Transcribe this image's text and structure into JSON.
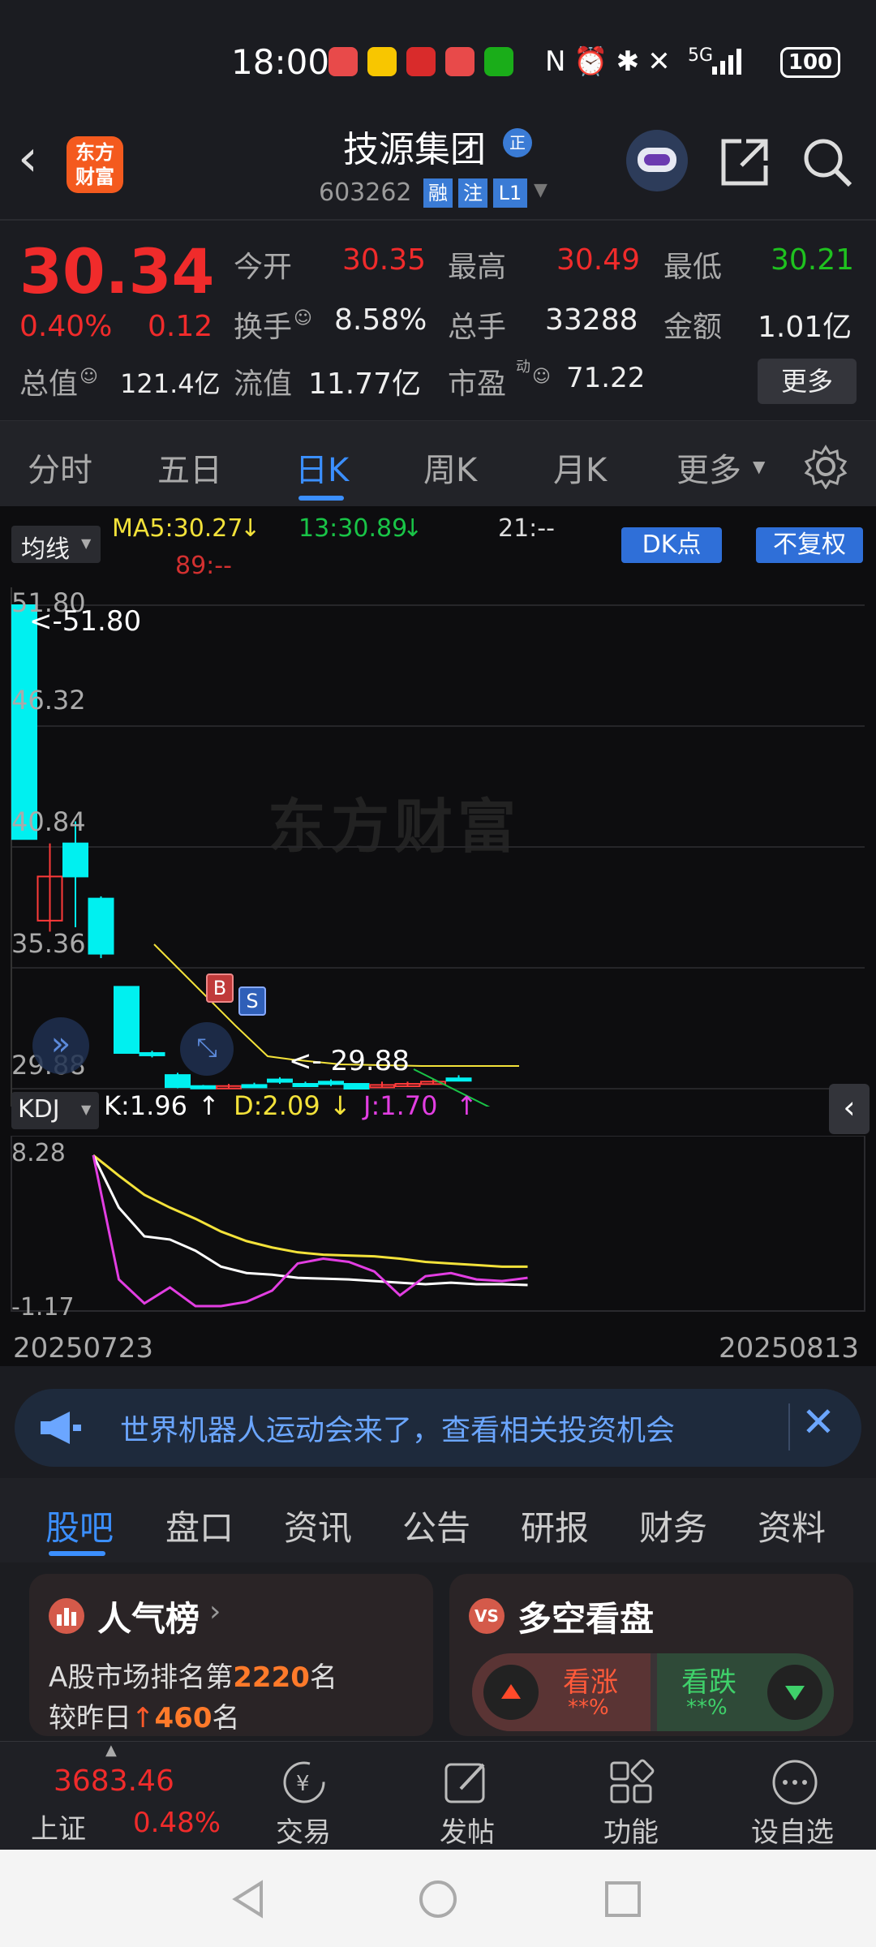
{
  "status": {
    "time": "18:00",
    "battery": "100",
    "net": "5G"
  },
  "header": {
    "logo_line1": "东方",
    "logo_line2": "财富",
    "stock_name": "技源集团",
    "stock_badge": "正",
    "code": "603262",
    "tag_rong": "融",
    "tag_zhu": "注",
    "tag_level": "L1"
  },
  "quote": {
    "price": "30.34",
    "pct": "0.40%",
    "chg": "0.12",
    "open_label": "今开",
    "open": "30.35",
    "high_label": "最高",
    "high": "30.49",
    "low_label": "最低",
    "low": "30.21",
    "turnover_label": "换手",
    "turnover": "8.58%",
    "volume_label": "总手",
    "volume": "33288",
    "amount_label": "金额",
    "amount": "1.01亿",
    "mcap_label": "总值",
    "mcap": "121.4亿",
    "float_label": "流值",
    "float": "11.77亿",
    "pe_label": "市盈",
    "pe_sup": "动",
    "pe": "71.22",
    "more_btn": "更多"
  },
  "period_tabs": [
    "分时",
    "五日",
    "日K",
    "周K",
    "月K",
    "更多"
  ],
  "active_tab": "日K",
  "chart": {
    "ma_btn": "均线",
    "ma5": "MA5:30.27",
    "ma5_arrow": "↓",
    "ma13": "13:30.89",
    "ma13_arrow": "↓",
    "ma21": "21:--",
    "ma89": "89:--",
    "dk_btn": "DK点",
    "fuquan_btn": "不复权",
    "y_top": "51.80",
    "y2": "46.32",
    "y3": "40.84",
    "y4": "35.36",
    "y_bot": "29.88",
    "hi_mark": "51.80",
    "lo_mark": "29.88",
    "buy": "B",
    "sell": "S",
    "kdj_btn": "KDJ",
    "k": "K:1.96",
    "k_arrow": "↑",
    "d": "D:2.09",
    "d_arrow": "↓",
    "j": "J:1.70",
    "j_arrow": "↑",
    "kdj_top": "8.28",
    "kdj_bot": "-1.17",
    "date_start": "20250723",
    "date_end": "20250813",
    "watermark": "东方财富"
  },
  "chart_data": {
    "type": "candlestick",
    "price_axis": [
      29.88,
      51.8
    ],
    "candles": [
      {
        "open": 51.8,
        "close": 41.2,
        "high": 51.8,
        "low": 41.2
      },
      {
        "open": 37.5,
        "close": 39.5,
        "high": 41.0,
        "low": 37.0
      },
      {
        "open": 41.0,
        "close": 39.5,
        "high": 42.0,
        "low": 37.2
      },
      {
        "open": 38.5,
        "close": 36.0,
        "high": 38.6,
        "low": 35.8
      },
      {
        "open": 34.5,
        "close": 31.5,
        "high": 34.5,
        "low": 31.5
      },
      {
        "open": 31.5,
        "close": 31.4,
        "high": 31.6,
        "low": 31.3
      },
      {
        "open": 30.5,
        "close": 29.95,
        "high": 30.6,
        "low": 29.9
      },
      {
        "open": 30.0,
        "close": 29.95,
        "high": 30.05,
        "low": 29.9
      },
      {
        "open": 30.0,
        "close": 30.0,
        "high": 30.1,
        "low": 29.9
      },
      {
        "open": 30.05,
        "close": 30.0,
        "high": 30.15,
        "low": 29.95
      },
      {
        "open": 30.3,
        "close": 30.2,
        "high": 30.4,
        "low": 30.1
      },
      {
        "open": 30.1,
        "close": 30.05,
        "high": 30.2,
        "low": 30.0
      },
      {
        "open": 30.2,
        "close": 30.1,
        "high": 30.3,
        "low": 30.0
      },
      {
        "open": 30.1,
        "close": 29.88,
        "high": 30.1,
        "low": 29.88
      },
      {
        "open": 30.0,
        "close": 30.05,
        "high": 30.2,
        "low": 29.95
      },
      {
        "open": 30.1,
        "close": 30.1,
        "high": 30.2,
        "low": 30.0
      },
      {
        "open": 30.2,
        "close": 30.2,
        "high": 30.3,
        "low": 30.1
      },
      {
        "open": 30.35,
        "close": 30.34,
        "high": 30.49,
        "low": 30.21
      }
    ],
    "kdj": {
      "range": [
        -1.17,
        8.28
      ],
      "K": [
        8.28,
        5.0,
        3.2,
        3.0,
        2.3,
        1.3,
        0.9,
        0.8,
        0.6,
        0.55,
        0.5,
        0.4,
        0.3,
        0.2,
        0.3,
        0.2,
        0.2,
        0.15
      ],
      "D": [
        8.28,
        7.0,
        5.8,
        5.0,
        4.3,
        3.5,
        2.9,
        2.5,
        2.2,
        2.05,
        2.0,
        1.95,
        1.8,
        1.6,
        1.5,
        1.4,
        1.3,
        1.3
      ],
      "J": [
        8.28,
        0.5,
        -1.0,
        0.0,
        -1.17,
        -1.17,
        -0.9,
        -0.2,
        1.5,
        1.8,
        1.6,
        1.0,
        -0.5,
        0.7,
        0.9,
        0.5,
        0.4,
        0.6
      ]
    }
  },
  "banner": {
    "text": "世界机器人运动会来了，查看相关投资机会"
  },
  "sub_tabs": [
    "股吧",
    "盘口",
    "资讯",
    "公告",
    "研报",
    "财务",
    "资料"
  ],
  "card_left": {
    "title": "人气榜",
    "line1_pre": "A股市场排名第",
    "rank": "2220",
    "line1_post": "名",
    "line2_pre": "较昨日",
    "change": "460",
    "line2_post": "名"
  },
  "card_right": {
    "title": "多空看盘",
    "up_label": "看涨",
    "up_pct": "**%",
    "down_label": "看跌",
    "down_pct": "**%"
  },
  "bottom_nav": {
    "index_value": "3683.46",
    "index_name": "上证",
    "index_pct": "0.48%",
    "items": [
      "交易",
      "发帖",
      "功能",
      "设自选"
    ]
  },
  "colors": {
    "up": "#f02b2b",
    "down": "#1fc21f",
    "accent": "#3a7bd5",
    "cyan": "#00ffff",
    "ma5": "#f3e23a"
  }
}
